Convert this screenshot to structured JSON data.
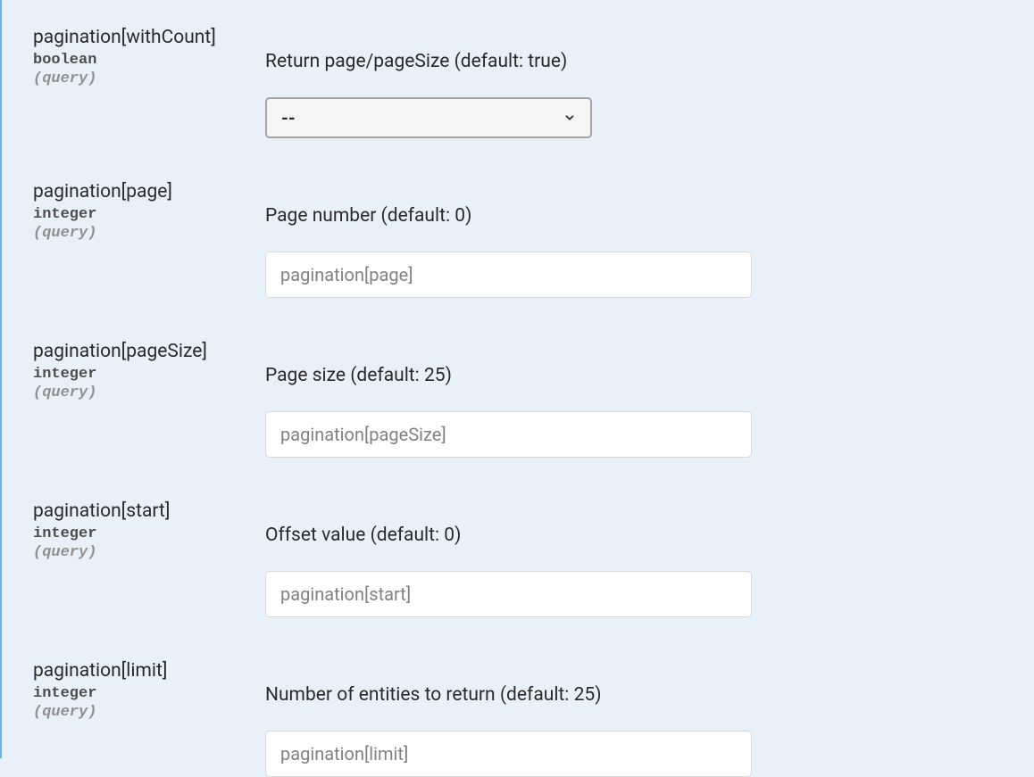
{
  "parameters": [
    {
      "name": "pagination[withCount]",
      "type": "boolean",
      "location": "(query)",
      "description": "Return page/pageSize (default: true)",
      "inputType": "select",
      "selectedLabel": "--",
      "options": [
        "--",
        "true",
        "false"
      ]
    },
    {
      "name": "pagination[page]",
      "type": "integer",
      "location": "(query)",
      "description": "Page number (default: 0)",
      "inputType": "text",
      "placeholder": "pagination[page]"
    },
    {
      "name": "pagination[pageSize]",
      "type": "integer",
      "location": "(query)",
      "description": "Page size (default: 25)",
      "inputType": "text",
      "placeholder": "pagination[pageSize]"
    },
    {
      "name": "pagination[start]",
      "type": "integer",
      "location": "(query)",
      "description": "Offset value (default: 0)",
      "inputType": "text",
      "placeholder": "pagination[start]"
    },
    {
      "name": "pagination[limit]",
      "type": "integer",
      "location": "(query)",
      "description": "Number of entities to return (default: 25)",
      "inputType": "text",
      "placeholder": "pagination[limit]"
    }
  ]
}
